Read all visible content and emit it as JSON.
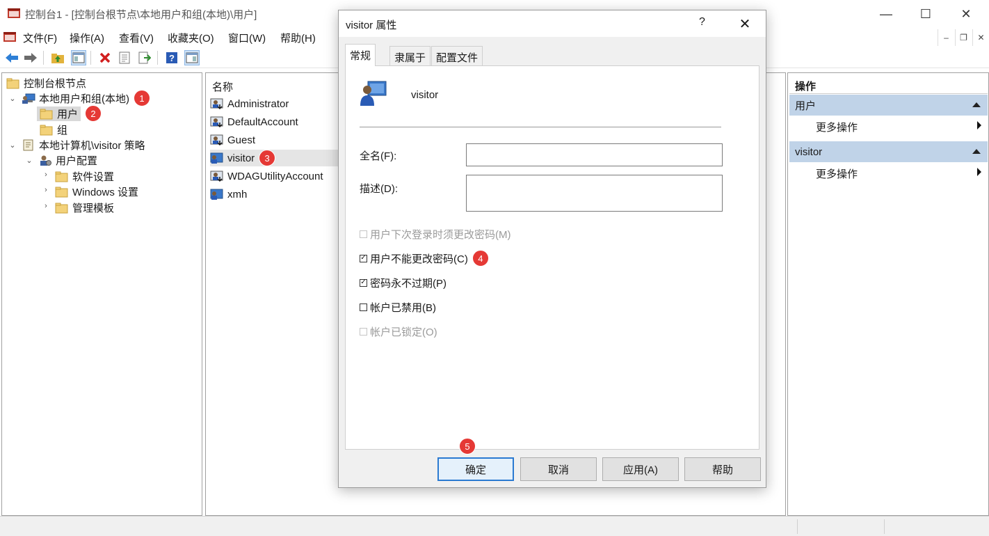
{
  "window": {
    "title": "控制台1 - [控制台根节点\\本地用户和组(本地)\\用户]",
    "minimize": "—",
    "maximize": "☐",
    "close": "✕"
  },
  "menu": {
    "items": [
      "文件(F)",
      "操作(A)",
      "查看(V)",
      "收藏夹(O)",
      "窗口(W)",
      "帮助(H)"
    ],
    "mdi_minimize": "‒",
    "mdi_restore": "❐",
    "mdi_close": "✕"
  },
  "toolbar": {
    "icons": [
      "back-arrow-icon",
      "forward-arrow-icon",
      "up-folder-icon",
      "show-hide-tree-icon",
      "delete-icon",
      "properties-icon",
      "export-list-icon",
      "help-icon",
      "show-hide-action-pane-icon"
    ]
  },
  "tree": {
    "root": "控制台根节点",
    "local_users_groups": "本地用户和组(本地)",
    "users": "用户",
    "groups": "组",
    "policy": "本地计算机\\visitor 策略",
    "user_config": "用户配置",
    "software_settings": "软件设置",
    "windows_settings": "Windows 设置",
    "admin_templates": "管理模板"
  },
  "list": {
    "header": "名称",
    "rows": [
      "Administrator",
      "DefaultAccount",
      "Guest",
      "visitor",
      "WDAGUtilityAccount",
      "xmh"
    ]
  },
  "actions": {
    "title": "操作",
    "group1": "用户",
    "group1_item": "更多操作",
    "group2": "visitor",
    "group2_item": "更多操作"
  },
  "dialog": {
    "title": "visitor 属性",
    "help": "?",
    "close": "✕",
    "tabs": [
      "常规",
      "隶属于",
      "配置文件"
    ],
    "user_name": "visitor",
    "fullname_label": "全名(F):",
    "fullname_value": "",
    "description_label": "描述(D):",
    "description_value": "",
    "checkboxes": [
      {
        "label": "用户下次登录时须更改密码(M)",
        "checked": false,
        "disabled": true
      },
      {
        "label": "用户不能更改密码(C)",
        "checked": true,
        "disabled": false
      },
      {
        "label": "密码永不过期(P)",
        "checked": true,
        "disabled": false
      },
      {
        "label": "帐户已禁用(B)",
        "checked": false,
        "disabled": false
      },
      {
        "label": "帐户已锁定(O)",
        "checked": false,
        "disabled": true
      }
    ],
    "buttons": {
      "ok": "确定",
      "cancel": "取消",
      "apply": "应用(A)",
      "help": "帮助"
    }
  },
  "badges": [
    "1",
    "2",
    "3",
    "4",
    "5"
  ],
  "colors": {
    "badge": "#e53935",
    "action_group": "#c0d3e8",
    "default_button_border": "#2b7ad1"
  }
}
